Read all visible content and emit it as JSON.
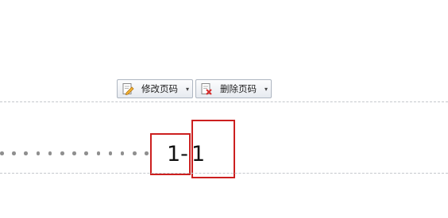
{
  "toolbar": {
    "edit_page_number": {
      "label": "修改页码",
      "icon": "edit-page-icon"
    },
    "delete_page_number": {
      "label": "删除页码",
      "icon": "delete-page-icon"
    },
    "caret": "▾"
  },
  "footer": {
    "page_number_left": "1-",
    "page_number_right": "1"
  },
  "colors": {
    "highlight": "#cc1f1f",
    "dashed_line": "#c4c7cc",
    "dot": "#8f8f8f"
  }
}
